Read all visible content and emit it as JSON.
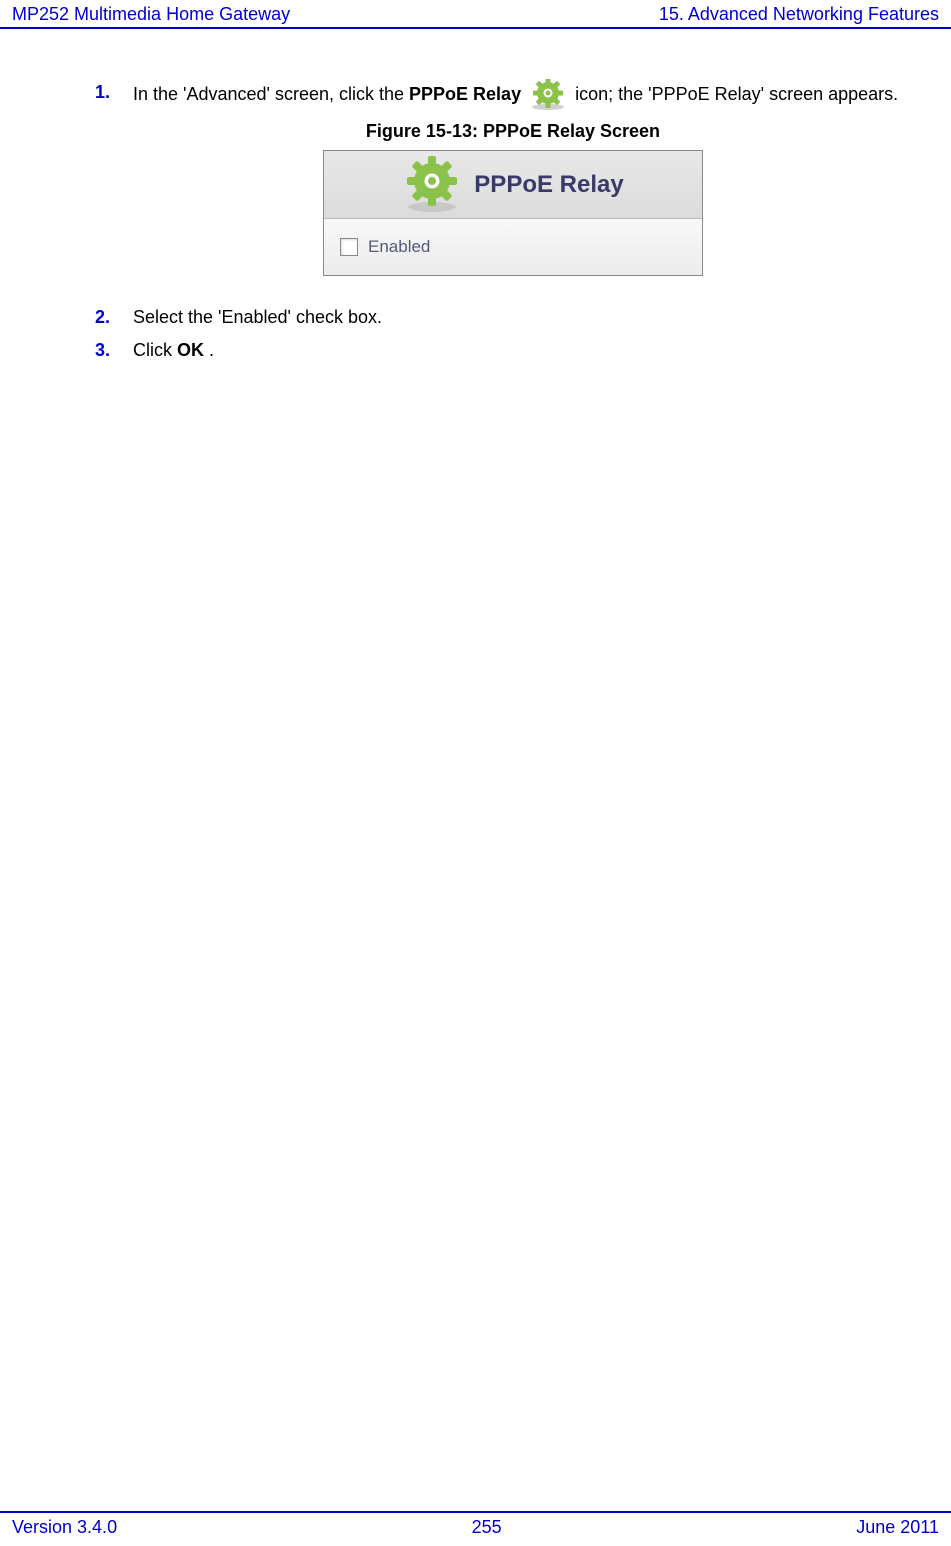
{
  "header": {
    "left": "MP252 Multimedia Home Gateway",
    "right": "15. Advanced Networking Features"
  },
  "steps": {
    "s1": {
      "num": "1.",
      "prefix": "In the 'Advanced' screen, click the ",
      "bold1": "PPPoE Relay",
      "after_icon": " icon; the 'PPPoE Relay' screen appears."
    },
    "s2": {
      "num": "2.",
      "text": "Select the 'Enabled' check box."
    },
    "s3": {
      "num": "3.",
      "prefix": "Click ",
      "bold": "OK",
      "suffix": "."
    }
  },
  "figure": {
    "caption": "Figure 15-13: PPPoE Relay Screen",
    "title": "PPPoE Relay",
    "checkbox_label": "Enabled"
  },
  "footer": {
    "left": "Version 3.4.0",
    "center": "255",
    "right": "June 2011"
  },
  "icons": {
    "gear_small": "gear-icon",
    "gear_large": "gear-icon"
  }
}
